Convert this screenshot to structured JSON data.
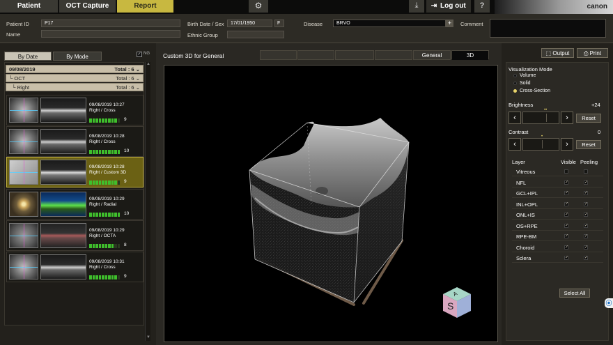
{
  "top_tabs": [
    {
      "label": "Patient",
      "active": false
    },
    {
      "label": "OCT Capture",
      "active": false
    },
    {
      "label": "Report",
      "active": true
    }
  ],
  "header": {
    "logout_label": "Log out",
    "help_label": "?",
    "brand": "canon",
    "icons": {
      "settings": "gear-icon",
      "download": "download-icon",
      "logout": "logout-icon"
    }
  },
  "patient": {
    "id_label": "Patient ID",
    "id_value": "P17",
    "name_label": "Name",
    "name_value": "",
    "birth_sex_label": "Birth Date / Sex",
    "birth_date": "17/01/1950",
    "sex": "F",
    "ethnic_label": "Ethnic Group",
    "ethnic_value": "",
    "disease_label": "Disease",
    "disease_value": "BRVO",
    "comment_label": "Comment",
    "comment_value": ""
  },
  "left": {
    "tabs": [
      {
        "label": "By Date",
        "active": true
      },
      {
        "label": "By Mode",
        "active": false
      }
    ],
    "ng_label": "NG",
    "groups": [
      {
        "label": "09/08/2019",
        "total": "Total : 6"
      },
      {
        "label": "OCT",
        "total": "Total : 6"
      },
      {
        "label": "Right",
        "total": "Total : 6"
      }
    ],
    "scans": [
      {
        "datetime": "09/08/2019 10:27",
        "desc": "Right / Cross",
        "quality": 9,
        "quality_label": "9",
        "selected": false,
        "style": "cross"
      },
      {
        "datetime": "09/08/2019 10:28",
        "desc": "Right / Cross",
        "quality": 10,
        "quality_label": "10",
        "selected": false,
        "style": "cross"
      },
      {
        "datetime": "09/08/2019 10:28",
        "desc": "Right / Custom 3D",
        "quality": 9,
        "quality_label": "9",
        "selected": true,
        "style": "3d"
      },
      {
        "datetime": "09/08/2019 10:29",
        "desc": "Right / Radial",
        "quality": 10,
        "quality_label": "10",
        "selected": false,
        "style": "radial"
      },
      {
        "datetime": "09/08/2019 10:29",
        "desc": "Right / OCTA",
        "quality": 8,
        "quality_label": "8",
        "selected": false,
        "style": "octa"
      },
      {
        "datetime": "09/08/2019 10:31",
        "desc": "Right / Cross",
        "quality": 9,
        "quality_label": "9",
        "selected": false,
        "style": "cross"
      }
    ]
  },
  "center": {
    "title": "Custom 3D for General",
    "tabs": [
      {
        "label": "",
        "active": false,
        "dim": true
      },
      {
        "label": "",
        "active": false,
        "dim": true
      },
      {
        "label": "",
        "active": false,
        "dim": true
      },
      {
        "label": "",
        "active": false,
        "dim": true
      },
      {
        "label": "General",
        "active": false,
        "dim": false
      },
      {
        "label": "3D",
        "active": true,
        "dim": false
      }
    ],
    "orientation_cube_label": "S"
  },
  "right": {
    "output_label": "Output",
    "print_label": "Print",
    "vis_mode_label": "Visualization Mode",
    "vis_modes": [
      {
        "label": "Volume",
        "selected": false
      },
      {
        "label": "Solid",
        "selected": false
      },
      {
        "label": "Cross-Section",
        "selected": true
      }
    ],
    "brightness_label": "Brightness",
    "brightness_value": "+24",
    "brightness_level": 0.62,
    "contrast_label": "Contrast",
    "contrast_value": "0",
    "contrast_level": 0.5,
    "reset_label": "Reset",
    "layer_header": "Layer",
    "visible_header": "Visible",
    "peeling_header": "Peeling",
    "layers": [
      {
        "name": "Vitreous",
        "visible": false,
        "peeling": false
      },
      {
        "name": "NFL",
        "visible": true,
        "peeling": true
      },
      {
        "name": "GCL+IPL",
        "visible": true,
        "peeling": true
      },
      {
        "name": "INL+OPL",
        "visible": true,
        "peeling": true
      },
      {
        "name": "ONL+IS",
        "visible": true,
        "peeling": true
      },
      {
        "name": "OS+RPE",
        "visible": true,
        "peeling": true
      },
      {
        "name": "RPE-BM",
        "visible": true,
        "peeling": true
      },
      {
        "name": "Choroid",
        "visible": true,
        "peeling": true
      },
      {
        "name": "Sclera",
        "visible": true,
        "peeling": true
      }
    ],
    "select_all_label": "Select All"
  }
}
